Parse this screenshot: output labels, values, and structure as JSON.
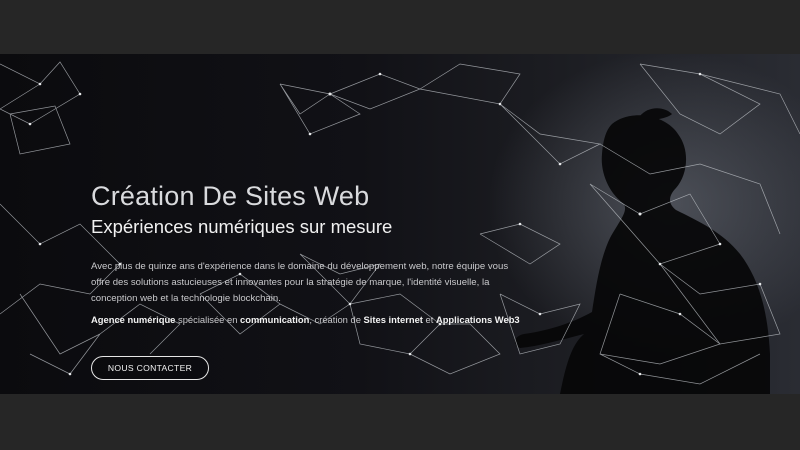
{
  "hero": {
    "title": "Création De Sites Web",
    "subtitle": "Expériences numériques sur mesure",
    "description": "Avec plus de quinze ans d'expérience dans le domaine du développement web, notre équipe vous offre des solutions astucieuses et innovantes pour la stratégie de marque, l'identité visuelle, la conception web et la technologie blockchain.",
    "tagline": {
      "part1": "Agence numérique",
      "part2": " spécialisée en ",
      "part3": "communication",
      "part4": ", création de ",
      "part5": "Sites internet",
      "part6": " et ",
      "part7": "Applications Web3"
    },
    "cta_label": "NOUS CONTACTER"
  },
  "colors": {
    "page_background": "#262626",
    "hero_dark": "#0b0b0e",
    "text": "#f2f2f2",
    "mesh_line": "#bfc3c8"
  }
}
